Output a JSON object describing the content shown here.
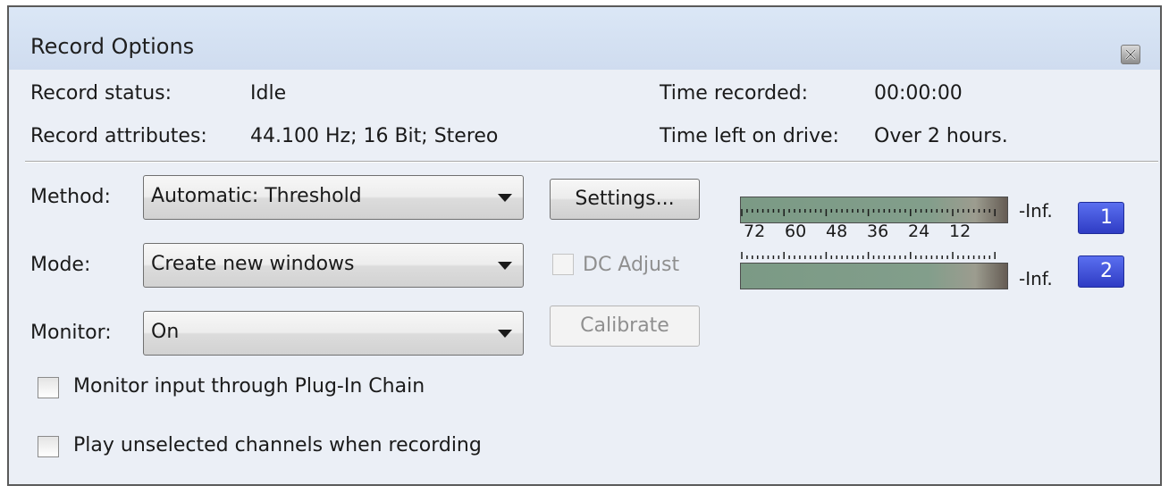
{
  "window": {
    "title": "Record Options",
    "close_icon": "close-icon"
  },
  "status": {
    "record_status_label": "Record status:",
    "record_status_value": "Idle",
    "record_attributes_label": "Record attributes:",
    "record_attributes_value": "44.100 Hz; 16 Bit; Stereo",
    "time_recorded_label": "Time recorded:",
    "time_recorded_value": "00:00:00",
    "time_left_label": "Time left on drive:",
    "time_left_value": "Over 2 hours."
  },
  "method": {
    "label": "Method:",
    "value": "Automatic: Threshold"
  },
  "mode": {
    "label": "Mode:",
    "value": "Create new windows"
  },
  "monitor": {
    "label": "Monitor:",
    "value": "On"
  },
  "buttons": {
    "settings": "Settings...",
    "calibrate": "Calibrate"
  },
  "dc_adjust": {
    "label": "DC Adjust",
    "checked": false,
    "enabled": false
  },
  "checkboxes": {
    "monitor_plugin_chain": {
      "label": "Monitor input through Plug-In Chain",
      "checked": false
    },
    "play_unselected": {
      "label": "Play unselected channels when recording",
      "checked": false
    }
  },
  "meters": {
    "channel_1": {
      "value_label": "-Inf.",
      "badge": "1"
    },
    "channel_2": {
      "value_label": "-Inf.",
      "badge": "2"
    },
    "scale_labels": [
      "72",
      "60",
      "48",
      "36",
      "24",
      "12"
    ]
  },
  "colors": {
    "window_bg": "#ebeff6",
    "titlebar_bg": "#d4e1f2",
    "channel_badge": "#3a4fd8",
    "meter_fill": "#7b9a85"
  }
}
